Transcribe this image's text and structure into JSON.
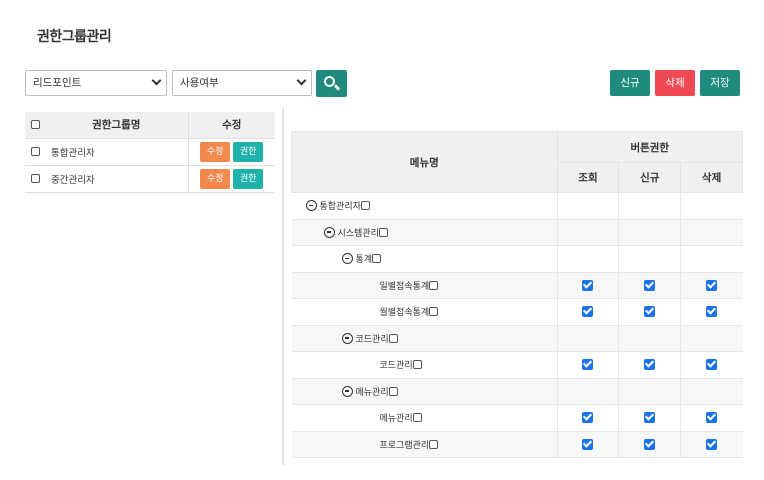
{
  "page": {
    "title": "권한그룹관리"
  },
  "filters": {
    "site_select": "리드포인트",
    "use_select": "사용여부"
  },
  "toolbar": {
    "new_label": "신규",
    "delete_label": "삭제",
    "save_label": "저장"
  },
  "colors": {
    "teal": "#1e8b7c",
    "red": "#ef4a54",
    "orange": "#f2894f",
    "cyan": "#20b2aa",
    "check": "#1a73e8"
  },
  "group_table": {
    "headers": {
      "name": "권한그룹명",
      "edit": "수정"
    },
    "rows": [
      {
        "name": "통합관리자",
        "edit_label": "수정",
        "perm_label": "권한"
      },
      {
        "name": "중간관리자",
        "edit_label": "수정",
        "perm_label": "권한"
      }
    ]
  },
  "menu_table": {
    "headers": {
      "menu": "메뉴명",
      "button_perm": "버튼권한",
      "view": "조회",
      "new": "신규",
      "delete": "삭제"
    },
    "rows": [
      {
        "label": "통합관리자",
        "level": 0,
        "collapsible": true,
        "checks": null
      },
      {
        "label": "시스템관리",
        "level": 1,
        "collapsible": true,
        "checks": null
      },
      {
        "label": "통계",
        "level": 2,
        "collapsible": true,
        "checks": null
      },
      {
        "label": "일별접속통계",
        "level": 3,
        "collapsible": false,
        "checks": [
          true,
          true,
          true
        ]
      },
      {
        "label": "월별접속통계",
        "level": 3,
        "collapsible": false,
        "checks": [
          true,
          true,
          true
        ]
      },
      {
        "label": "코드관리",
        "level": 2,
        "collapsible": true,
        "checks": null
      },
      {
        "label": "코드관리",
        "level": 3,
        "collapsible": false,
        "checks": [
          true,
          true,
          true
        ]
      },
      {
        "label": "메뉴관리",
        "level": 2,
        "collapsible": true,
        "checks": null
      },
      {
        "label": "메뉴관리",
        "level": 3,
        "collapsible": false,
        "checks": [
          true,
          true,
          true
        ]
      },
      {
        "label": "프로그램관리",
        "level": 3,
        "collapsible": false,
        "checks": [
          true,
          true,
          true
        ]
      }
    ]
  }
}
